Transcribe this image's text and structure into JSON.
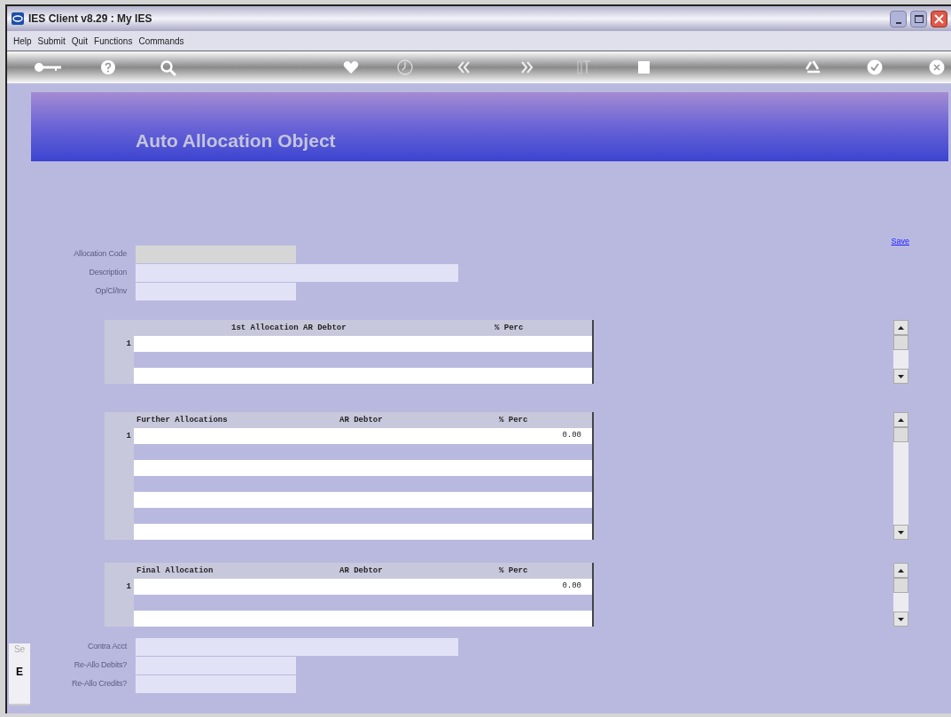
{
  "window": {
    "title": "IES Client v8.29 : My IES"
  },
  "menu": [
    "Help",
    "Submit",
    "Quit",
    "Functions",
    "Commands"
  ],
  "banner": {
    "title": "Auto Allocation Object"
  },
  "save_link": "Save",
  "fields_top": [
    {
      "label": "Allocation Code",
      "disabled": true
    },
    {
      "label": "Description",
      "disabled": false
    },
    {
      "label": "Op/Cl/Inv",
      "disabled": false
    }
  ],
  "tables": [
    {
      "columns": [
        "1st Allocation AR Debtor",
        "% Perc"
      ],
      "rows": [
        {
          "number": "1"
        }
      ]
    },
    {
      "columns": [
        "Further Allocations",
        "AR Debtor",
        "% Perc"
      ],
      "rows": [
        {
          "number": "1",
          "perc": "0.00"
        }
      ]
    },
    {
      "columns": [
        "Final Allocation",
        "AR Debtor",
        "% Perc"
      ],
      "rows": [
        {
          "number": "1",
          "perc": "0.00"
        }
      ]
    }
  ],
  "fields_bottom": [
    {
      "label": "Contra Acct",
      "disabled": false
    },
    {
      "label": "Re-Allo Debits?",
      "disabled": false
    },
    {
      "label": "Re-Allo Credits?",
      "disabled": false
    }
  ],
  "side_panel": {
    "text": "Se",
    "key": "E"
  }
}
